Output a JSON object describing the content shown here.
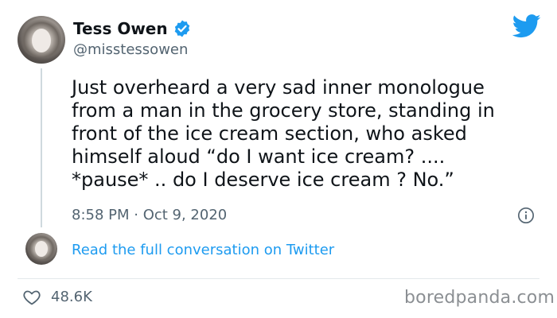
{
  "tweet": {
    "author_name": "Tess Owen",
    "handle": "@misstessowen",
    "text": "Just overheard a very sad inner monologue\nfrom a man in the grocery store, standing in\nfront of the ice cream section, who asked\nhimself aloud “do I want ice cream? ....\n*pause* .. do I deserve ice cream ? No.”",
    "timestamp": "8:58 PM · Oct 9, 2020",
    "likes": "48.6K",
    "read_more_label": "Read the full conversation on Twitter"
  },
  "icons": {
    "verified": "verified-badge-icon",
    "brand": "twitter-bird-icon",
    "info": "info-icon",
    "like": "heart-icon"
  },
  "colors": {
    "twitter_blue": "#1d9bf0",
    "secondary_text": "#536471",
    "primary_text": "#0f1419"
  },
  "watermark": "boredpanda.com"
}
